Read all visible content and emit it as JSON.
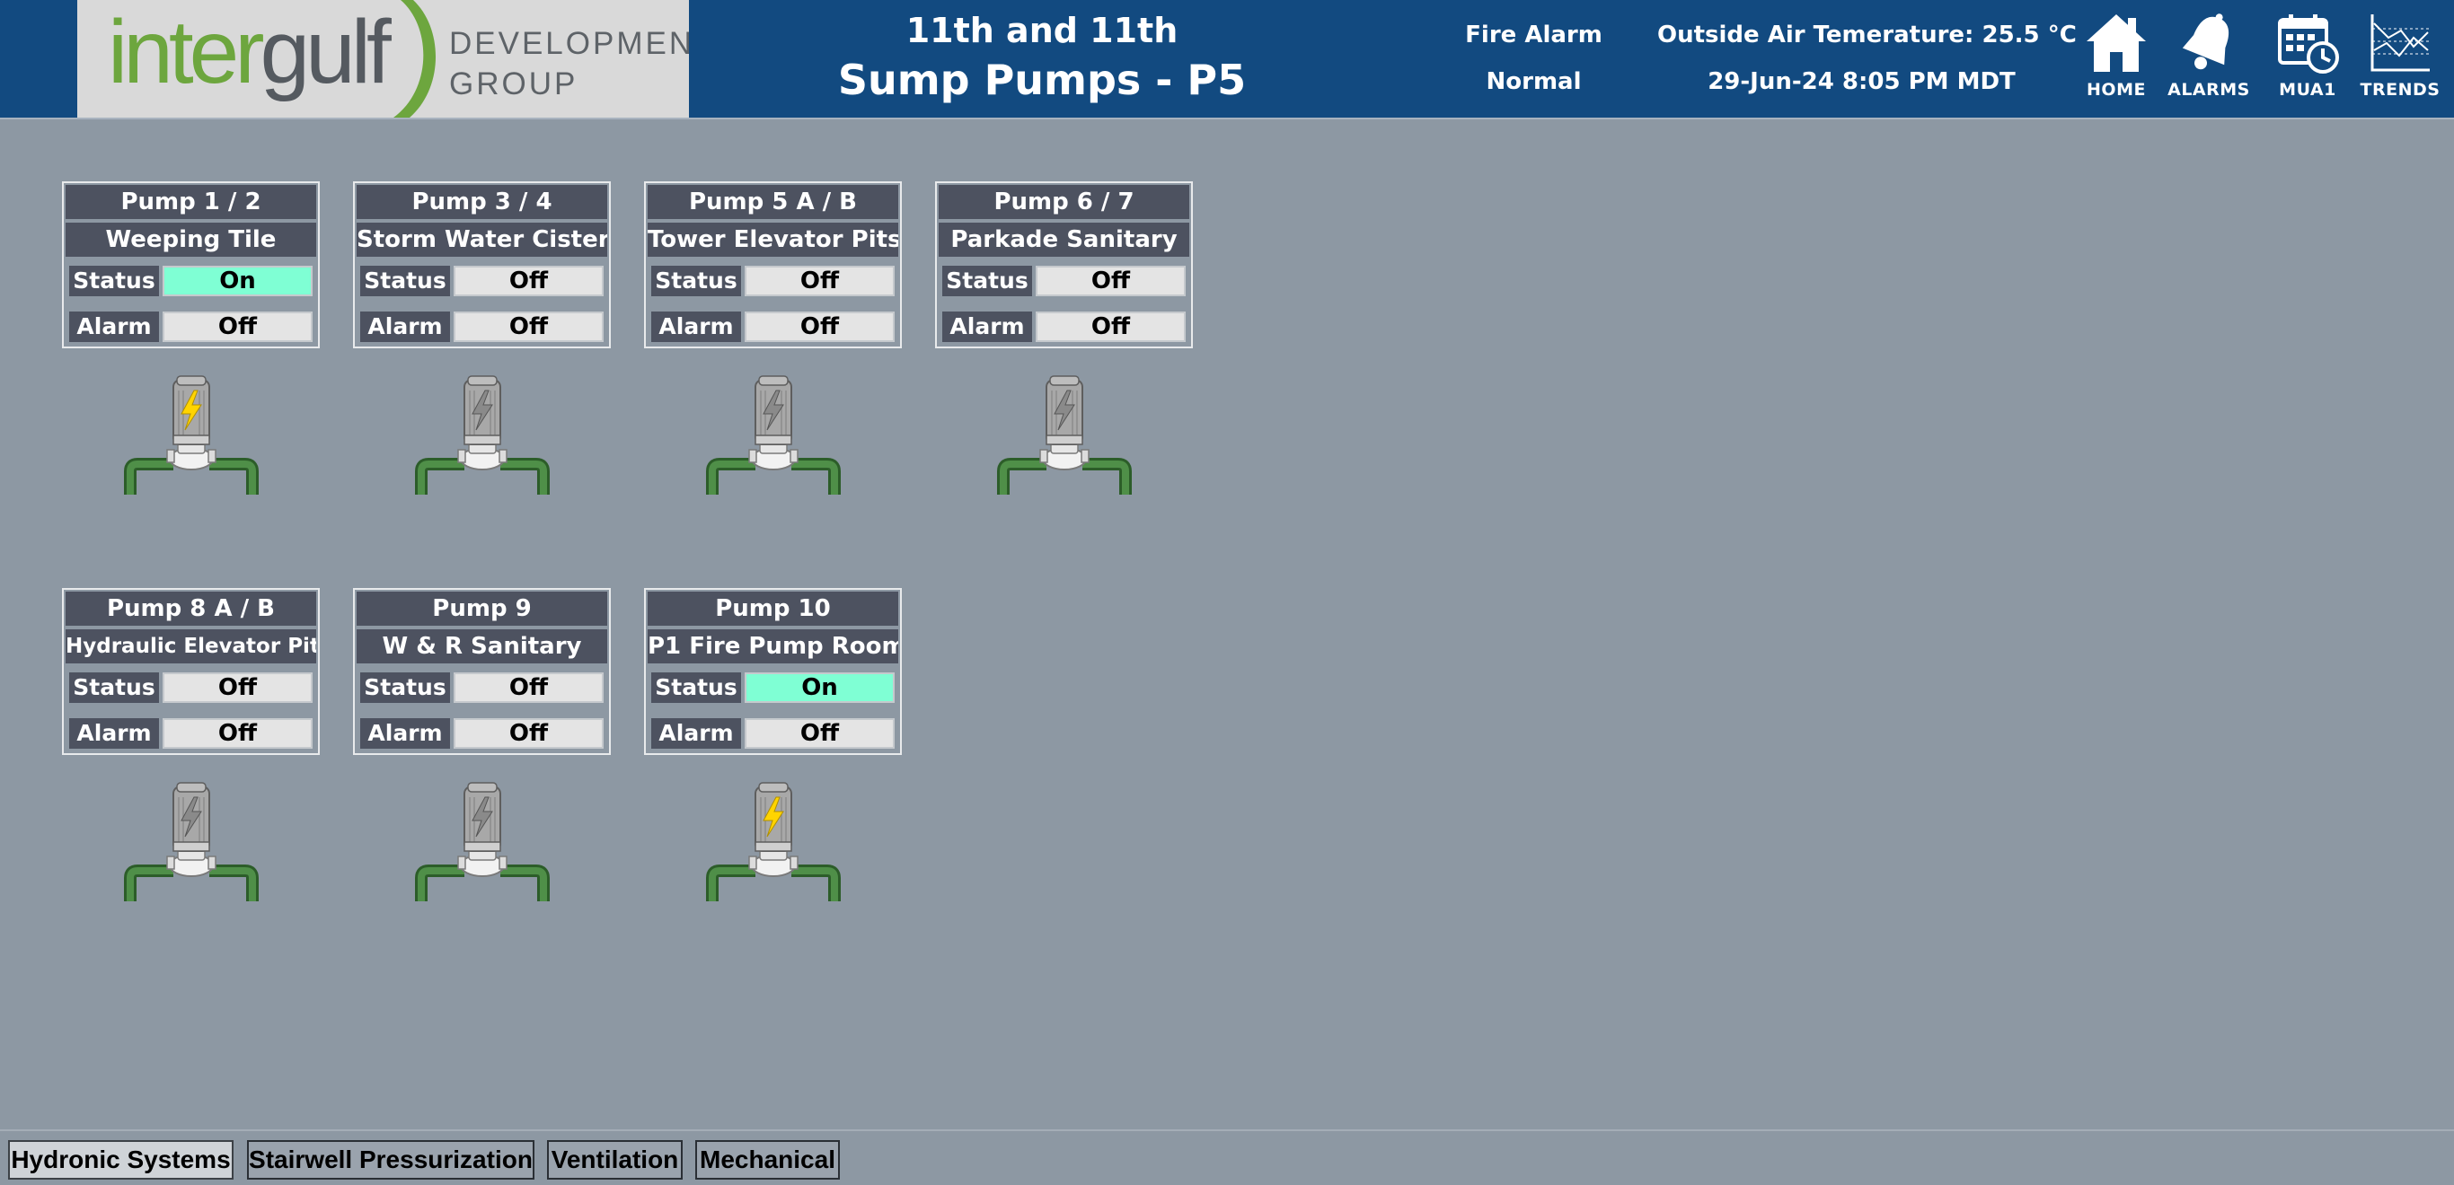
{
  "header": {
    "logo_word_part1": "inter",
    "logo_word_part2": "gulf",
    "logo_sub_line1": "DEVELOPMENT",
    "logo_sub_line2": "GROUP",
    "title_line1": "11th and 11th",
    "title_line2": "Sump Pumps - P5",
    "fire_alarm_label": "Fire Alarm",
    "fire_alarm_value": "Normal",
    "outside_air": "Outside Air Temerature: 25.5 °C",
    "datetime": "29-Jun-24 8:05 PM MDT",
    "nav": [
      {
        "label": "HOME",
        "icon": "home-icon"
      },
      {
        "label": "ALARMS",
        "icon": "bell-icon"
      },
      {
        "label": "MUA1",
        "icon": "calendar-clock-icon"
      },
      {
        "label": "TRENDS",
        "icon": "trend-chart-icon"
      }
    ]
  },
  "labels": {
    "status": "Status",
    "alarm": "Alarm"
  },
  "pumps": [
    {
      "title": "Pump 1 / 2",
      "subtitle": "Weeping Tile",
      "status": "On",
      "alarm": "Off"
    },
    {
      "title": "Pump 3 / 4",
      "subtitle": "Storm Water Cistern",
      "status": "Off",
      "alarm": "Off"
    },
    {
      "title": "Pump 5 A / B",
      "subtitle": "Tower Elevator Pits",
      "status": "Off",
      "alarm": "Off"
    },
    {
      "title": "Pump 6 / 7",
      "subtitle": "Parkade Sanitary",
      "status": "Off",
      "alarm": "Off"
    },
    {
      "title": "Pump 8 A / B",
      "subtitle": "Hydraulic Elevator Pit",
      "status": "Off",
      "alarm": "Off"
    },
    {
      "title": "Pump 9",
      "subtitle": "W & R Sanitary",
      "status": "Off",
      "alarm": "Off"
    },
    {
      "title": "Pump 10",
      "subtitle": "P1 Fire Pump Room",
      "status": "On",
      "alarm": "Off"
    }
  ],
  "colors": {
    "header_bg": "#124a80",
    "page_bg": "#8d98a3",
    "on_value_bg": "#7fffd4",
    "off_value_bg": "#e4e4e4",
    "running_bolt": "#ffd400",
    "idle_bolt": "#8a8a8a",
    "pipe_green": "#3e7d3a"
  },
  "tabs": [
    {
      "label": "Hydronic Systems",
      "active": true
    },
    {
      "label": "Stairwell Pressurization",
      "active": false
    },
    {
      "label": "Ventilation",
      "active": false
    },
    {
      "label": "Mechanical",
      "active": false
    }
  ]
}
